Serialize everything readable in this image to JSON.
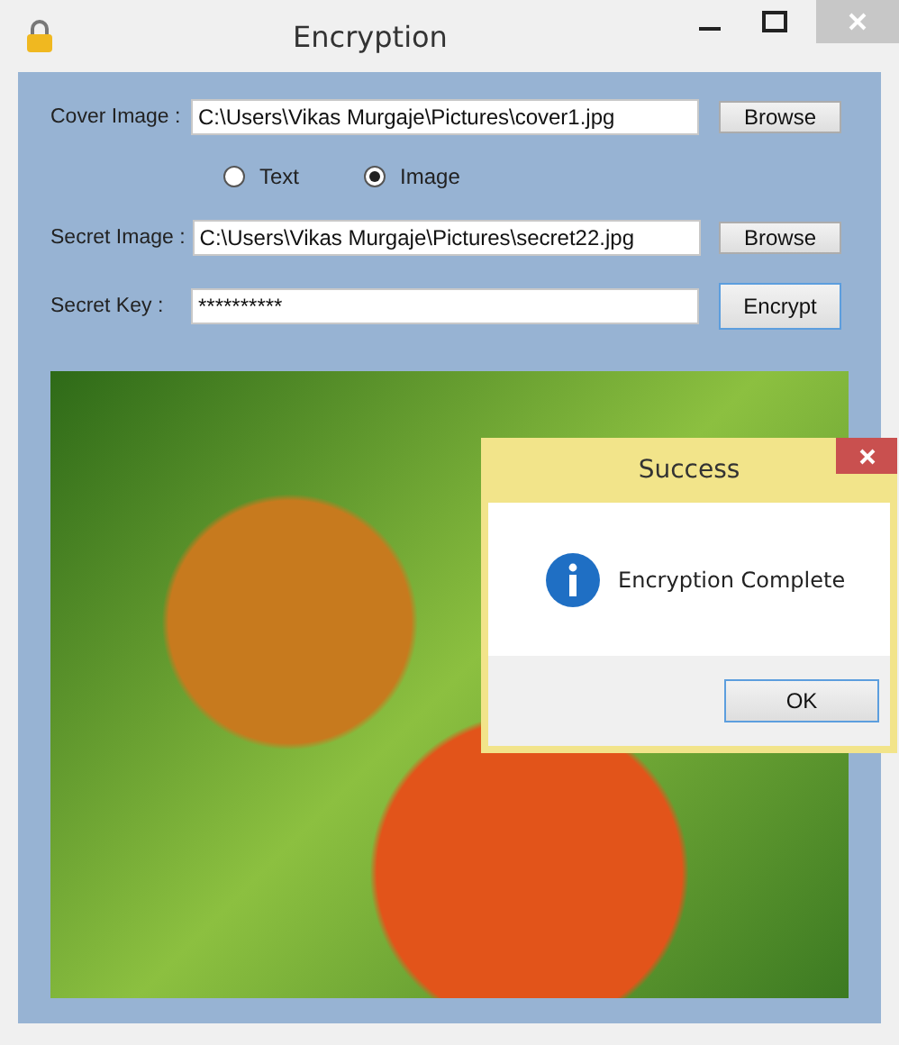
{
  "window": {
    "title": "Encryption"
  },
  "cover_image": {
    "label": "Cover Image :",
    "value": "C:\\Users\\Vikas Murgaje\\Pictures\\cover1.jpg",
    "button": "Browse"
  },
  "mode_options": [
    {
      "label": "Text",
      "selected": false
    },
    {
      "label": "Image",
      "selected": true
    }
  ],
  "secret_image": {
    "label": "Secret Image :",
    "value": "C:\\Users\\Vikas Murgaje\\Pictures\\secret22.jpg",
    "button": "Browse"
  },
  "secret_key": {
    "label": "Secret Key :",
    "value": "**********",
    "button": "Encrypt"
  },
  "dialog": {
    "title": "Success",
    "message": "Encryption Complete",
    "button": "OK"
  }
}
